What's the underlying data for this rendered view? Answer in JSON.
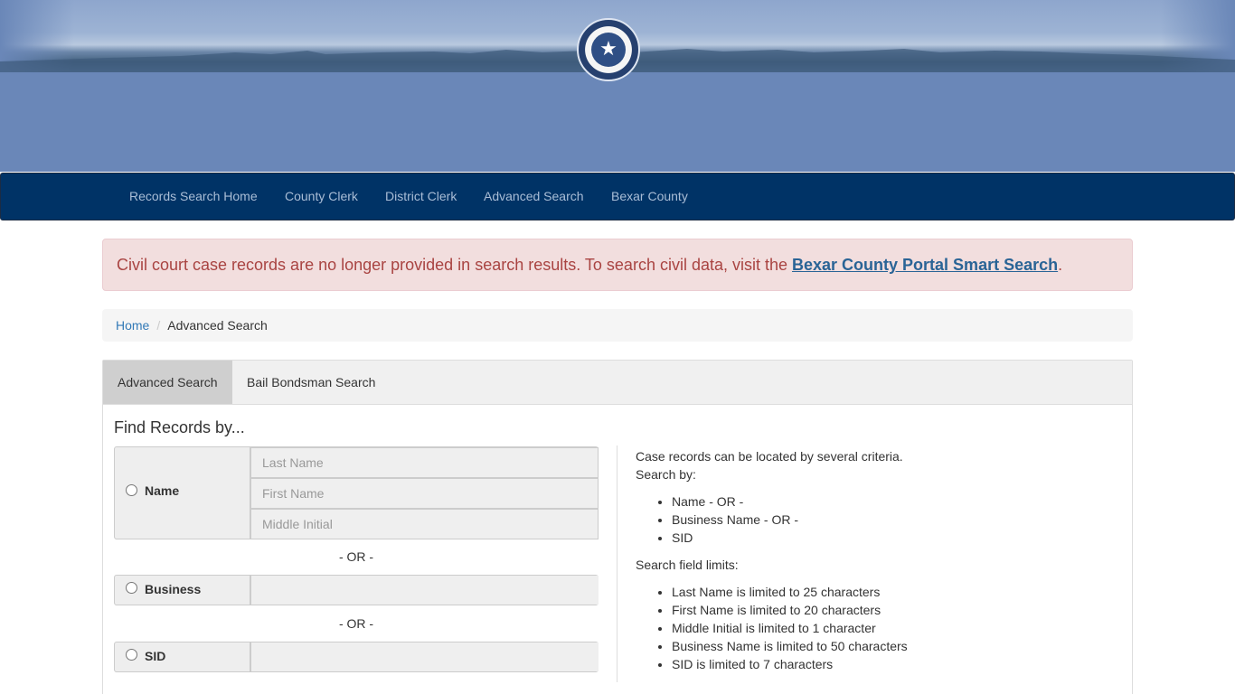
{
  "header": {
    "seal_icon": "texas-state-seal-icon",
    "seal_glyph": "★"
  },
  "nav": {
    "items": [
      {
        "label": "Records Search Home"
      },
      {
        "label": "County Clerk"
      },
      {
        "label": "District Clerk"
      },
      {
        "label": "Advanced Search"
      },
      {
        "label": "Bexar County"
      }
    ]
  },
  "alert": {
    "text": "Civil court case records are no longer provided in search results. To search civil data, visit the ",
    "link": "Bexar County Portal Smart Search",
    "suffix": "."
  },
  "breadcrumb": {
    "home": "Home",
    "separator": "/",
    "current": "Advanced Search"
  },
  "tabs": [
    {
      "label": "Advanced Search",
      "active": true
    },
    {
      "label": "Bail Bondsman Search",
      "active": false
    }
  ],
  "form": {
    "title": "Find Records by...",
    "name_label": "Name",
    "last_name_placeholder": "Last Name",
    "first_name_placeholder": "First Name",
    "middle_initial_placeholder": "Middle Initial",
    "or_label": "- OR -",
    "business_label": "Business",
    "business_value": "",
    "sid_label": "SID",
    "sid_value": ""
  },
  "help": {
    "intro_line1": "Case records can be located by several criteria.",
    "intro_line2": "Search by:",
    "criteria": [
      "Name - OR -",
      "Business Name - OR -",
      "SID"
    ],
    "limits_title": "Search field limits:",
    "limits": [
      "Last Name is limited to 25 characters",
      "First Name is limited to 20 characters",
      "Middle Initial is limited to 1 character",
      "Business Name is limited to 50 characters",
      "SID is limited to 7 characters"
    ]
  },
  "colors": {
    "header_blue": "#6a87b8",
    "navbar": "#003366",
    "alert_bg": "#f2dede",
    "alert_text": "#a94442",
    "link": "#337ab7"
  }
}
